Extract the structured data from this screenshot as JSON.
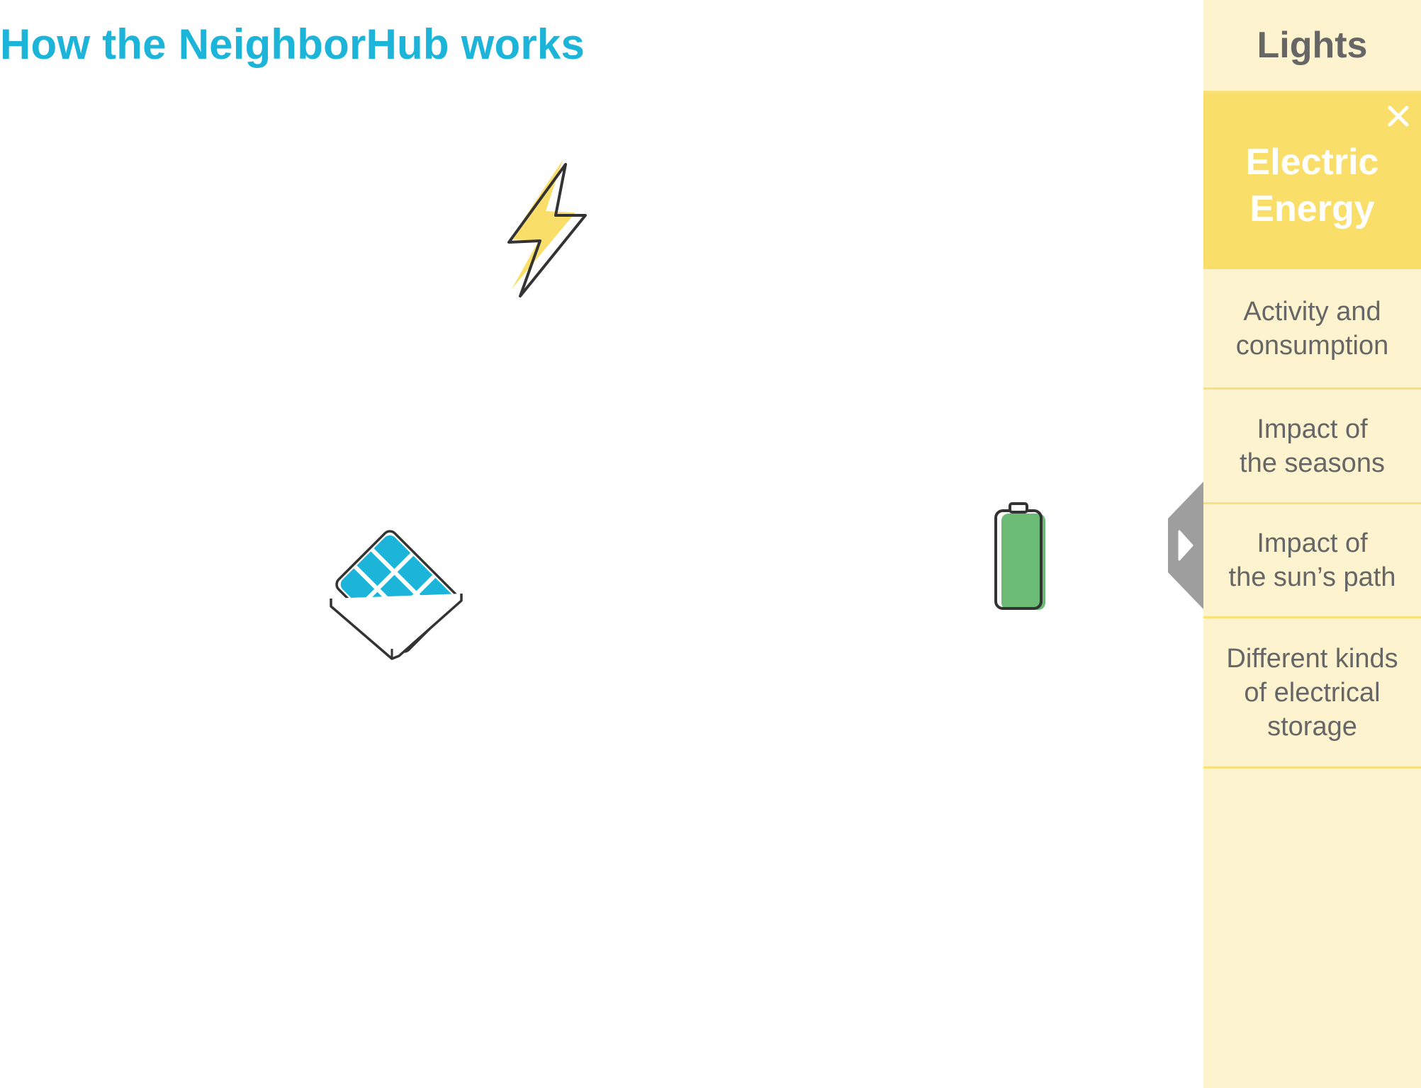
{
  "page": {
    "title": "How the NeighborHub works"
  },
  "diagram": {
    "icons": [
      {
        "name": "lightning-icon",
        "color": "#f9de69"
      },
      {
        "name": "solar-panel-icon",
        "color": "#1cb4d8"
      },
      {
        "name": "battery-icon",
        "color": "#6bbb77"
      }
    ]
  },
  "sidebar": {
    "header": "Lights",
    "active_item": "Electric\nEnergy",
    "close_icon": "close-icon",
    "items": [
      {
        "label": "Activity and\nconsumption"
      },
      {
        "label": "Impact of\nthe seasons"
      },
      {
        "label": "Impact of\nthe sun’s path"
      },
      {
        "label": "Different kinds\nof electrical\nstorage"
      }
    ]
  },
  "collapse_tab": {
    "icon": "play-arrow-icon",
    "color": "#9e9e9e"
  },
  "colors": {
    "title": "#1cb4d8",
    "sidebar_bg": "#fdf3cf",
    "sidebar_active": "#f9de69",
    "sidebar_divider": "#f8e07a",
    "sidebar_text": "#666666"
  }
}
